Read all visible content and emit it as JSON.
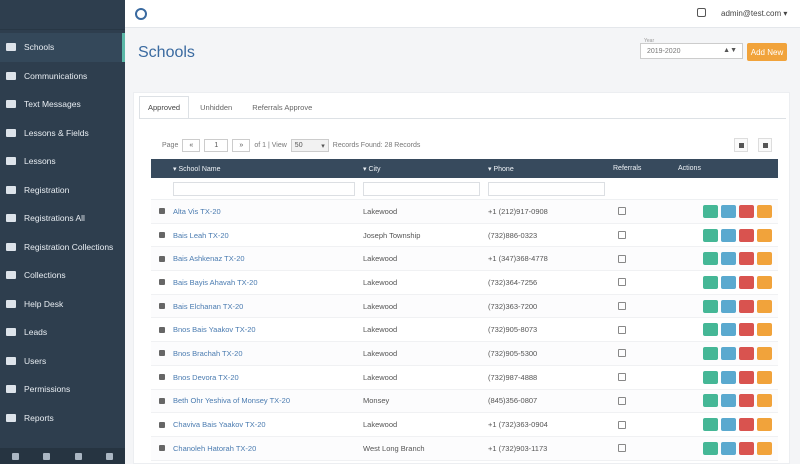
{
  "app": {
    "user_email": "admin@test.com"
  },
  "sidebar": {
    "items": [
      {
        "label": "Schools",
        "active": true
      },
      {
        "label": "Communications",
        "active": false
      },
      {
        "label": "Text Messages",
        "active": false
      },
      {
        "label": "Lessons & Fields",
        "active": false
      },
      {
        "label": "Lessons",
        "active": false
      },
      {
        "label": "Registration",
        "active": false
      },
      {
        "label": "Registrations All",
        "active": false
      },
      {
        "label": "Registration Collections",
        "active": false
      },
      {
        "label": "Collections",
        "active": false
      },
      {
        "label": "Help Desk",
        "active": false
      },
      {
        "label": "Leads",
        "active": false
      },
      {
        "label": "Users",
        "active": false
      },
      {
        "label": "Permissions",
        "active": false
      },
      {
        "label": "Reports",
        "active": false
      }
    ]
  },
  "page": {
    "title": "Schools",
    "year_label": "Year",
    "year_value": "2019-2020",
    "add_button": "Add New"
  },
  "tabs": [
    {
      "label": "Approved",
      "active": true
    },
    {
      "label": "Unhidden",
      "active": false
    },
    {
      "label": "Referrals Approve",
      "active": false
    }
  ],
  "pager": {
    "page_label": "Page",
    "page_value": "1",
    "of_label": "of 1 | View",
    "per_page": "50",
    "summary": "Records Found: 28 Records"
  },
  "table": {
    "columns": [
      "School Name",
      "City",
      "Phone",
      "Referrals",
      "Actions"
    ],
    "rows": [
      {
        "name": "Alta Vis TX-20",
        "city": "Lakewood",
        "phone": "+1 (212)917-0908"
      },
      {
        "name": "Bais Leah TX-20",
        "city": "Joseph Township",
        "phone": "(732)886-0323"
      },
      {
        "name": "Bais Ashkenaz TX-20",
        "city": "Lakewood",
        "phone": "+1 (347)368-4778"
      },
      {
        "name": "Bais Bayis Ahavah TX-20",
        "city": "Lakewood",
        "phone": "(732)364-7256"
      },
      {
        "name": "Bais Elchanan TX-20",
        "city": "Lakewood",
        "phone": "(732)363-7200"
      },
      {
        "name": "Bnos Bais Yaakov TX-20",
        "city": "Lakewood",
        "phone": "(732)905-8073"
      },
      {
        "name": "Bnos Brachah TX-20",
        "city": "Lakewood",
        "phone": "(732)905-5300"
      },
      {
        "name": "Bnos Devora TX-20",
        "city": "Lakewood",
        "phone": "(732)987-4888"
      },
      {
        "name": "Beth Ohr Yeshiva of Monsey TX-20",
        "city": "Monsey",
        "phone": "(845)356-0807"
      },
      {
        "name": "Chaviva Bais Yaakov TX-20",
        "city": "Lakewood",
        "phone": "+1 (732)363-0904"
      },
      {
        "name": "Chanoleh Hatorah TX-20",
        "city": "West Long Branch",
        "phone": "+1 (732)903-1173"
      }
    ]
  },
  "colors": {
    "sidebar": "#2e3e4e",
    "header": "#374a5d",
    "accent": "#f1a33b",
    "link": "#4a7bb0"
  }
}
